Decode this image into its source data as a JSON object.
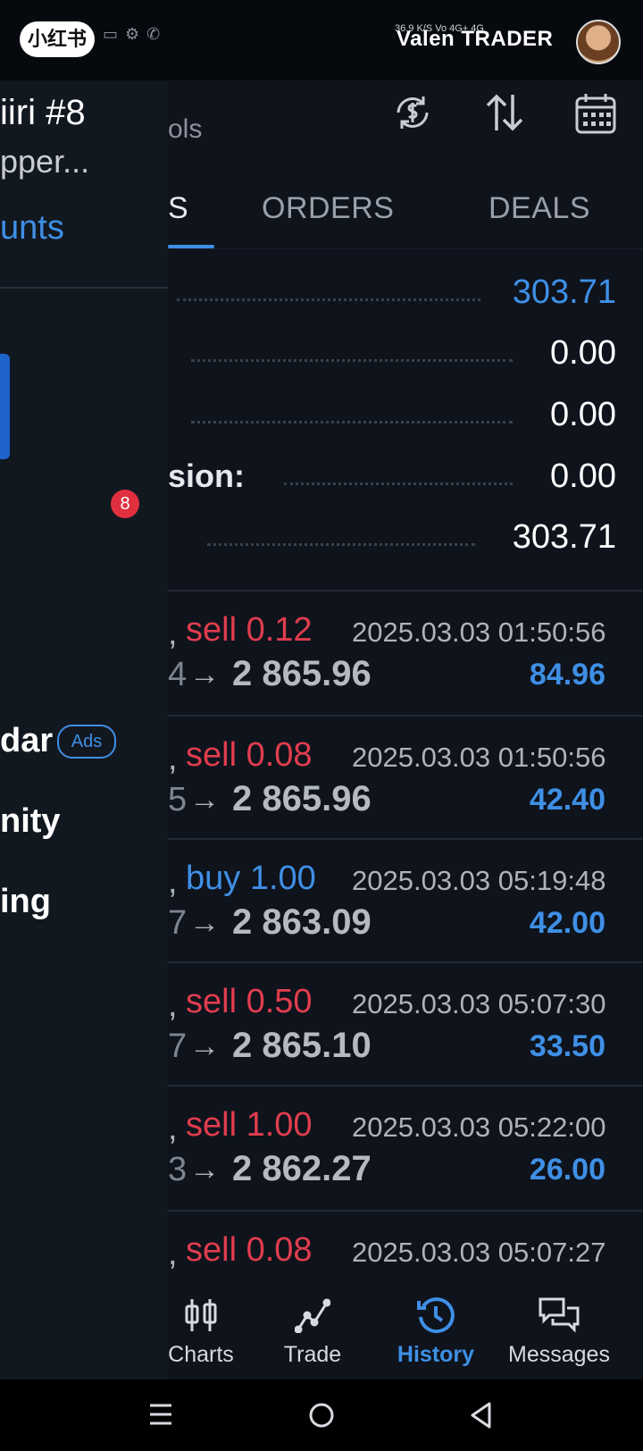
{
  "status_bar": {
    "badge_text": "小红书",
    "watermark": "Valen TRADER",
    "network": "36.9 K/S  Vo  4G+  4G"
  },
  "drawer": {
    "title": "iiri #8",
    "subtitle": "pper...",
    "accounts_link": "unts",
    "notification_count": "8",
    "items": {
      "calendar": "dar",
      "community": "nity",
      "trading": "ing"
    },
    "ads_badge": "Ads"
  },
  "header": {
    "title_fragment": "ols"
  },
  "tabs": {
    "positions": "S",
    "orders": "ORDERS",
    "deals": "DEALS"
  },
  "summary": {
    "rows": [
      {
        "label": "",
        "value": "303.71",
        "color": "#3f8fe5"
      },
      {
        "label": "",
        "value": "0.00",
        "color": "#ffffff"
      },
      {
        "label": "",
        "value": "0.00",
        "color": "#ffffff"
      },
      {
        "label": "sion:",
        "value": "0.00",
        "color": "#ffffff"
      },
      {
        "label": "",
        "value": "303.71",
        "color": "#ffffff"
      }
    ]
  },
  "deals": [
    {
      "type": "sell 0.12",
      "side": "sell",
      "time": "2025.03.03 01:50:56",
      "ghost": "4",
      "price": "2 865.96",
      "profit": "84.96"
    },
    {
      "type": "sell 0.08",
      "side": "sell",
      "time": "2025.03.03 01:50:56",
      "ghost": "5",
      "price": "2 865.96",
      "profit": "42.40"
    },
    {
      "type": "buy 1.00",
      "side": "buy",
      "time": "2025.03.03 05:19:48",
      "ghost": "7",
      "price": "2 863.09",
      "profit": "42.00"
    },
    {
      "type": "sell 0.50",
      "side": "sell",
      "time": "2025.03.03 05:07:30",
      "ghost": "7",
      "price": "2 865.10",
      "profit": "33.50"
    },
    {
      "type": "sell 1.00",
      "side": "sell",
      "time": "2025.03.03 05:22:00",
      "ghost": "3",
      "price": "2 862.27",
      "profit": "26.00"
    },
    {
      "type": "sell 0.08",
      "side": "sell",
      "time": "2025.03.03 05:07:27",
      "ghost": "",
      "price": "",
      "profit": ""
    }
  ],
  "bottom_nav": {
    "charts": "Charts",
    "trade": "Trade",
    "history": "History",
    "messages": "Messages",
    "active": "history",
    "active_color": "#3f8fe5"
  },
  "colors": {
    "accent": "#3f8fe5",
    "sell": "#e03d4e",
    "background": "#0e131c",
    "drawer": "#121820"
  }
}
